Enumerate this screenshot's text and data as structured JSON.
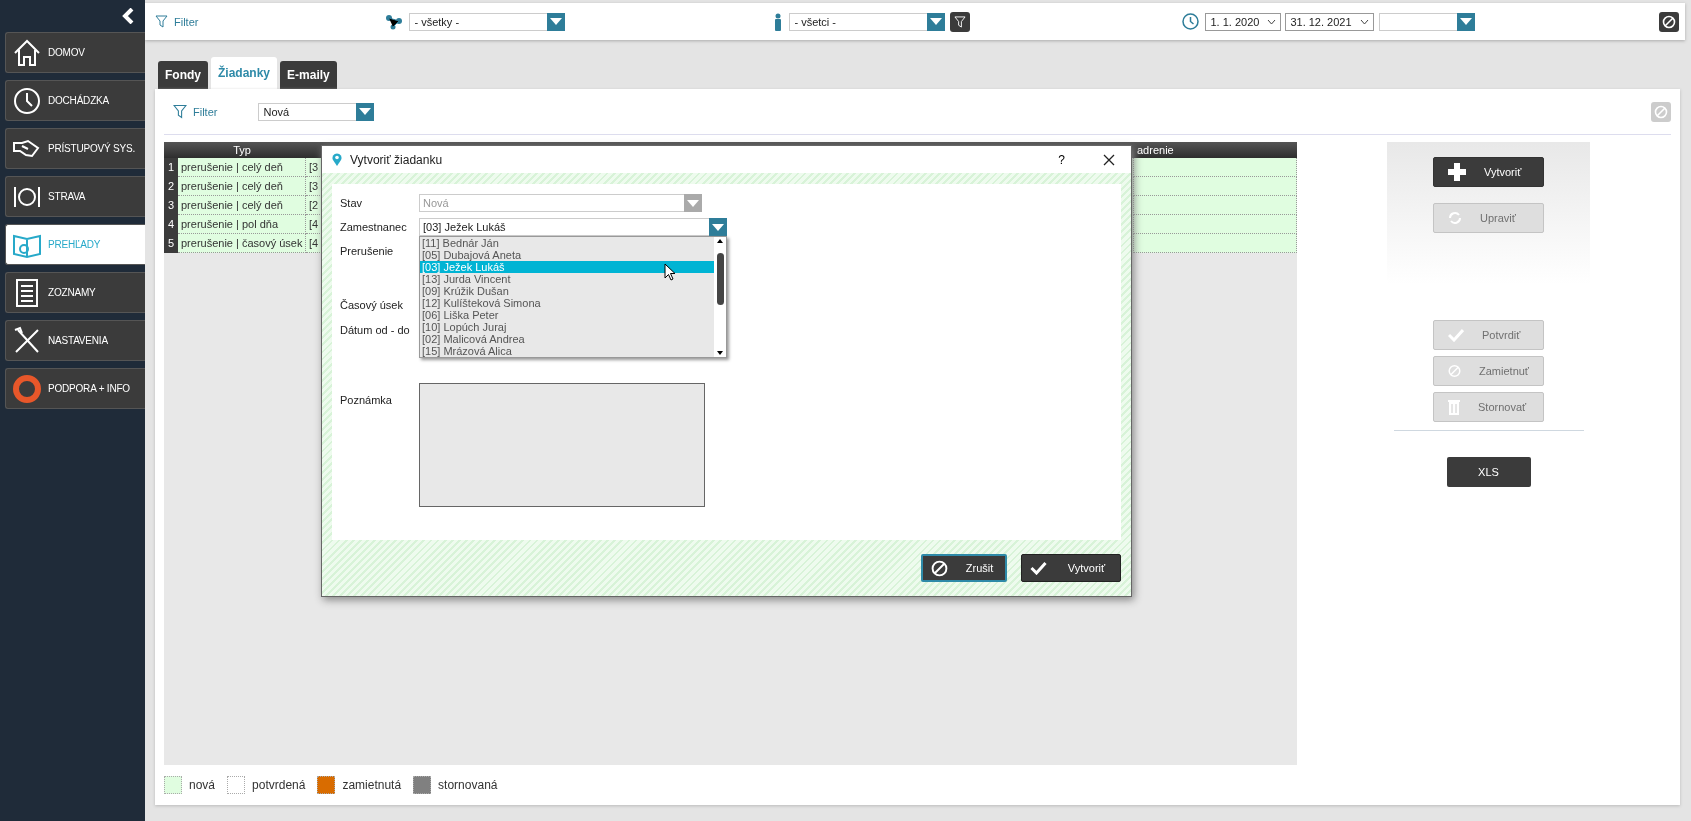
{
  "sidebar": {
    "items": [
      {
        "label": "DOMOV",
        "selected": false
      },
      {
        "label": "DOCHÁDZKA",
        "selected": false
      },
      {
        "label": "PRÍSTUPOVÝ SYS.",
        "selected": false
      },
      {
        "label": "STRAVA",
        "selected": false
      },
      {
        "label": "PREHĽADY",
        "selected": true
      },
      {
        "label": "ZOZNAMY",
        "selected": false
      },
      {
        "label": "NASTAVENIA",
        "selected": false
      },
      {
        "label": "PODPORA + INFO",
        "selected": false
      }
    ]
  },
  "top_filter": {
    "label": "Filter",
    "group_select": "- všetky -",
    "person_select": "- všetci -",
    "date_from": "1. 1. 2020",
    "date_to": "31. 12. 2021"
  },
  "tabs": [
    {
      "label": "Fondy",
      "selected": false
    },
    {
      "label": "Žiadanky",
      "selected": true
    },
    {
      "label": "E-maily",
      "selected": false
    }
  ],
  "filter": {
    "label": "Filter",
    "status_select": "Nová"
  },
  "table": {
    "columns": [
      "Typ",
      "adrenie"
    ],
    "rows": [
      {
        "number": "1",
        "type": "prerušenie | celý deň",
        "column_2": "[3"
      },
      {
        "number": "2",
        "type": "prerušenie | celý deň",
        "column_2": "[3"
      },
      {
        "number": "3",
        "type": "prerušenie | celý deň",
        "column_2": "[2"
      },
      {
        "number": "4",
        "type": "prerušenie | pol dňa",
        "column_2": "[4"
      },
      {
        "number": "5",
        "type": "prerušenie | časový úsek",
        "column_2": "[4"
      }
    ]
  },
  "actions": [
    {
      "label": "Vytvoriť",
      "kind": "create",
      "disabled": false
    },
    {
      "label": "Upraviť",
      "kind": "edit",
      "disabled": true
    }
  ],
  "status_actions": [
    {
      "label": "Potvrdiť",
      "kind": "confirm",
      "disabled": true
    },
    {
      "label": "Zamietnuť",
      "kind": "reject",
      "disabled": true
    },
    {
      "label": "Stornovať",
      "kind": "cancel",
      "disabled": true
    }
  ],
  "export_button": "XLS",
  "legend": [
    {
      "label": "nová",
      "color": "#e0fde0"
    },
    {
      "label": "potvrdená",
      "color": "#ffffff"
    },
    {
      "label": "zamietnutá",
      "color": "#d96c00"
    },
    {
      "label": "stornovaná",
      "color": "#808080"
    }
  ],
  "dialog": {
    "title": "Vytvoriť žiadanku",
    "help": "?",
    "fields": [
      {
        "label": "Stav",
        "kind": "select",
        "value": "Nová",
        "disabled": true,
        "expanded": false
      },
      {
        "label": "Zamestnanec",
        "kind": "select",
        "value": "[03] Ježek Lukáš",
        "disabled": false,
        "expanded": true
      },
      {
        "label": "Prerušenie",
        "kind": "blank"
      },
      {
        "label": "Časový úsek",
        "kind": "blank"
      },
      {
        "label": "Dátum od - do",
        "kind": "blank"
      },
      {
        "label": "Poznámka",
        "kind": "textarea"
      }
    ],
    "options": [
      {
        "label": "[11] Bednár Ján",
        "selected": false
      },
      {
        "label": "[05] Dubajová Aneta",
        "selected": false
      },
      {
        "label": "[03] Ježek Lukáš",
        "selected": true
      },
      {
        "label": "[13] Jurda Vincent",
        "selected": false
      },
      {
        "label": "[09] Krúžik Dušan",
        "selected": false
      },
      {
        "label": "[12] Kulíšteková Simona",
        "selected": false
      },
      {
        "label": "[06] Liška Peter",
        "selected": false
      },
      {
        "label": "[10] Lopúch Juraj",
        "selected": false
      },
      {
        "label": "[02] Malicová Andrea",
        "selected": false
      },
      {
        "label": "[15] Mrázová Alica",
        "selected": false
      }
    ],
    "buttons": [
      {
        "label": "Zrušit",
        "kind": "cancel"
      },
      {
        "label": "Vytvoriť",
        "kind": "ok"
      }
    ]
  }
}
